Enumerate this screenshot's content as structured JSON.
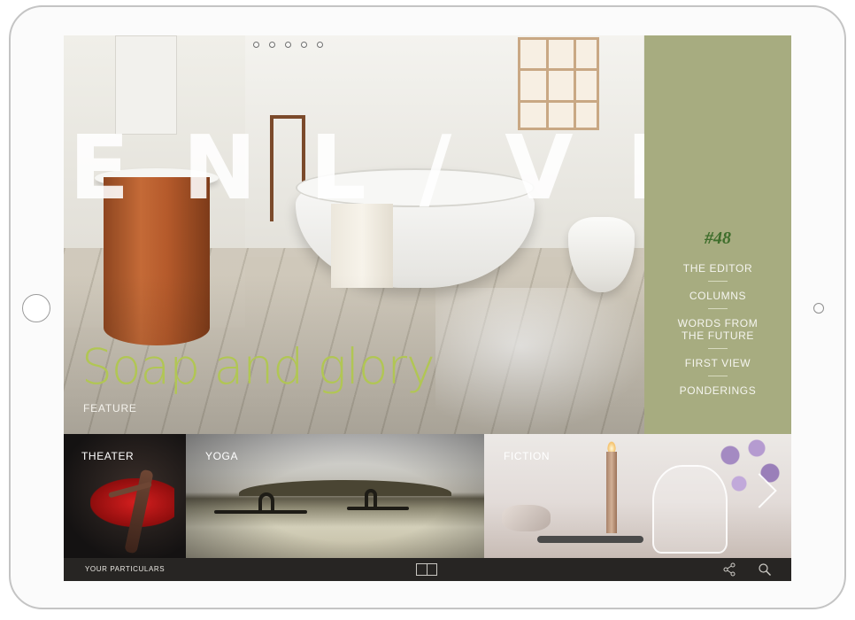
{
  "masthead": {
    "title": "ENL/VEN"
  },
  "page_indicator": {
    "pages": 5,
    "current": 1
  },
  "menu": {
    "issue": "#48",
    "items": [
      {
        "label": "THE EDITOR"
      },
      {
        "label": "COLUMNS"
      },
      {
        "label": "WORDS FROM\nTHE FUTURE"
      },
      {
        "label": "FIRST VIEW"
      },
      {
        "label": "PONDERINGS"
      }
    ]
  },
  "feature": {
    "title": "Soap and glory",
    "tag": "FEATURE"
  },
  "tiles": [
    {
      "label": "THEATER"
    },
    {
      "label": "YOGA"
    },
    {
      "label": "FICTION"
    }
  ],
  "bottom_bar": {
    "particulars": "YOUR PARTICULARS",
    "icons": [
      "spread-view-icon",
      "share-icon",
      "search-icon"
    ]
  },
  "colors": {
    "menu_panel": "#a7ac80",
    "issue_number": "#3f6e2c",
    "feature_title": "#b1c654"
  }
}
